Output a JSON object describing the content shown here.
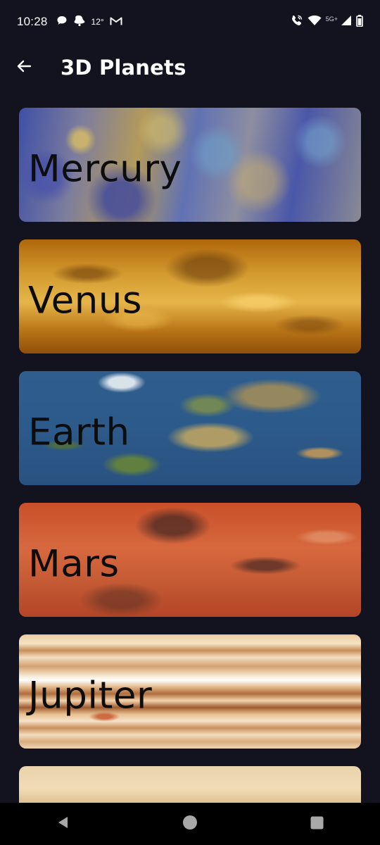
{
  "status_bar": {
    "time": "10:28",
    "temperature": "12°",
    "network": "5G+",
    "left_icons": [
      "chat-bubble-icon",
      "notification-bell-icon",
      "gmail-icon"
    ],
    "right_icons": [
      "wifi-calling-icon",
      "wifi-icon",
      "signal-icon",
      "battery-icon"
    ]
  },
  "app_bar": {
    "back_icon": "arrow-left-icon",
    "title": "3D Planets"
  },
  "planets": [
    {
      "name": "Mercury"
    },
    {
      "name": "Venus"
    },
    {
      "name": "Earth"
    },
    {
      "name": "Mars"
    },
    {
      "name": "Jupiter"
    },
    {
      "name": ""
    }
  ],
  "nav_bar": {
    "buttons": [
      "back-triangle-icon",
      "home-circle-icon",
      "recents-square-icon"
    ]
  },
  "colors": {
    "background": "#13121f",
    "text_on_card": "#0d0d0d",
    "nav_background": "#000000"
  }
}
